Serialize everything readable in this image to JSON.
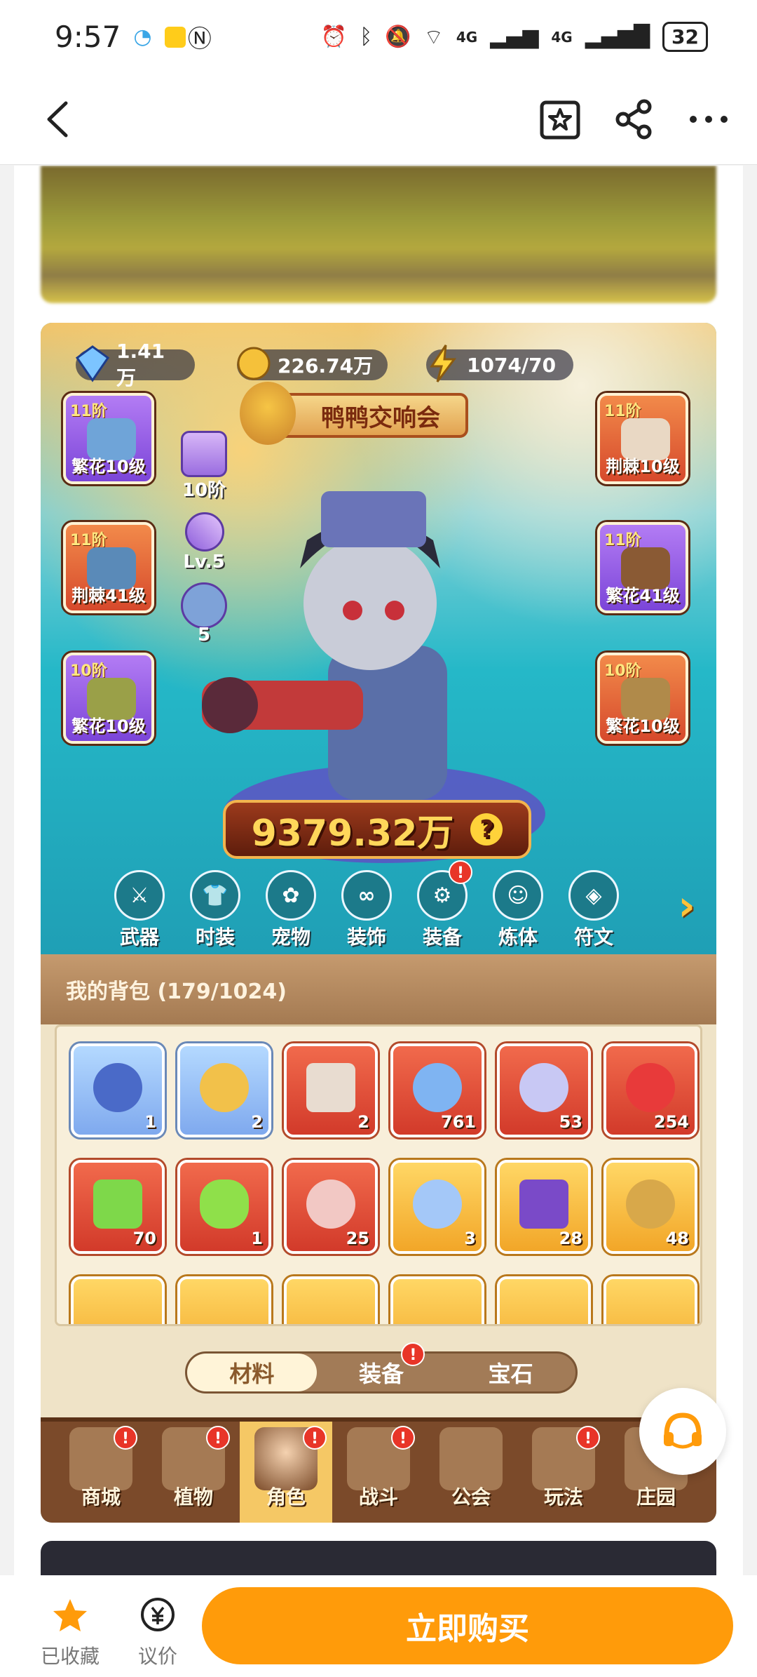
{
  "status": {
    "time": "9:57",
    "network1": "4G",
    "network2": "4G",
    "battery": "32"
  },
  "game": {
    "resources": [
      {
        "icon": "diamond-icon",
        "value": "1.41万"
      },
      {
        "icon": "coin-icon",
        "value": "226.74万"
      },
      {
        "icon": "energy-icon",
        "value": "1074/70"
      }
    ],
    "event_title": "鸭鸭交响会",
    "left_slots": [
      {
        "tier": "11阶",
        "label": "繁花10级",
        "color": "purple",
        "icon": "helmet-icon"
      },
      {
        "tier": "11阶",
        "label": "荆棘41级",
        "color": "orange",
        "icon": "glove-icon"
      },
      {
        "tier": "10阶",
        "label": "繁花10级",
        "color": "purple",
        "icon": "pants-icon"
      }
    ],
    "right_slots": [
      {
        "tier": "11阶",
        "label": "荆棘10级",
        "color": "orange",
        "icon": "armor-icon"
      },
      {
        "tier": "11阶",
        "label": "繁花41级",
        "color": "purple",
        "icon": "belt-icon"
      },
      {
        "tier": "10阶",
        "label": "繁花10级",
        "color": "orange",
        "icon": "boots-icon"
      }
    ],
    "mini_stats": [
      {
        "label": "10阶",
        "icon": "pet-paw-icon"
      },
      {
        "label": "Lv.5",
        "icon": "crystal-icon"
      },
      {
        "label": "5",
        "icon": "star-orb-icon"
      }
    ],
    "power": "9379.32万",
    "menu": [
      {
        "label": "武器",
        "icon": "weapon-icon"
      },
      {
        "label": "时装",
        "icon": "fashion-icon"
      },
      {
        "label": "宠物",
        "icon": "pet-icon"
      },
      {
        "label": "装饰",
        "icon": "mask-icon"
      },
      {
        "label": "装备",
        "icon": "equipment-icon",
        "alert": "!"
      },
      {
        "label": "炼体",
        "icon": "body-icon"
      },
      {
        "label": "符文",
        "icon": "rune-icon"
      }
    ],
    "bag_title": "我的背包 (179/1024)",
    "items_row1": [
      {
        "count": "1",
        "color": "blue",
        "icon": "mask-item-icon"
      },
      {
        "count": "2",
        "color": "blue",
        "icon": "star-item-icon"
      },
      {
        "count": "2",
        "color": "red",
        "icon": "cube-item-icon"
      },
      {
        "count": "761",
        "color": "red",
        "icon": "crystal-star-icon"
      },
      {
        "count": "53",
        "color": "red",
        "icon": "moon-star-icon"
      },
      {
        "count": "254",
        "color": "red",
        "icon": "potion-icon"
      }
    ],
    "items_row2": [
      {
        "count": "70",
        "color": "red",
        "icon": "battery-icon"
      },
      {
        "count": "1",
        "color": "red",
        "icon": "green-capsule-icon"
      },
      {
        "count": "25",
        "color": "red",
        "icon": "flower-icon"
      },
      {
        "count": "3",
        "color": "gold",
        "icon": "water-drop-icon"
      },
      {
        "count": "28",
        "color": "gold",
        "icon": "skull-book-icon"
      },
      {
        "count": "48",
        "color": "gold",
        "icon": "key-icon"
      }
    ],
    "bag_tabs": [
      {
        "label": "材料",
        "active": true
      },
      {
        "label": "装备",
        "alert": "!"
      },
      {
        "label": "宝石"
      }
    ],
    "bottom_nav": [
      {
        "label": "商城",
        "alert": "!"
      },
      {
        "label": "植物",
        "alert": "!"
      },
      {
        "label": "角色",
        "alert": "!",
        "active": true
      },
      {
        "label": "战斗",
        "alert": "!"
      },
      {
        "label": "公会"
      },
      {
        "label": "玩法",
        "alert": "!"
      },
      {
        "label": "庄园"
      }
    ]
  },
  "footer": {
    "favorite_label": "已收藏",
    "bargain_label": "议价",
    "buy_label": "立即购买"
  },
  "colors": {
    "accent": "#ff9b0a",
    "alert": "#e83528"
  }
}
